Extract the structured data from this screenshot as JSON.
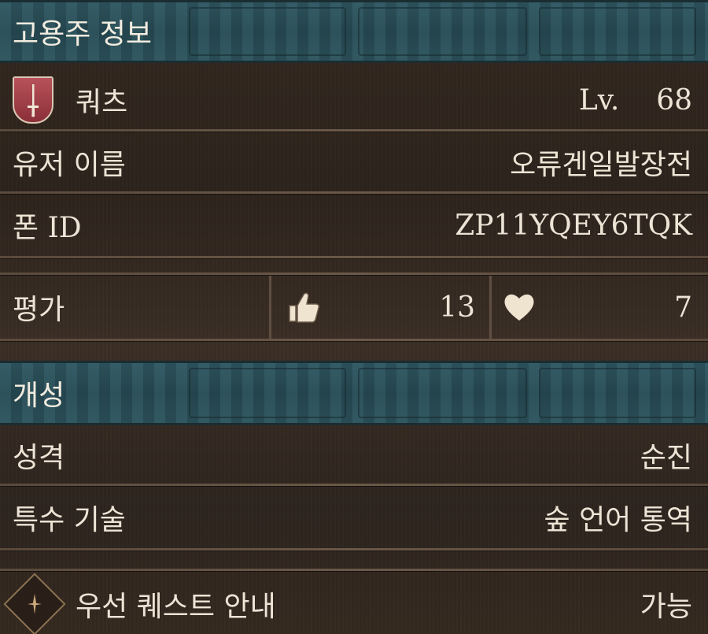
{
  "mercenary_info": {
    "header": "고용주 정보",
    "name": "쿼츠",
    "level_label": "Lv.",
    "level": "68",
    "username_label": "유저 이름",
    "username": "오류겐일발장전",
    "pawn_id_label": "폰 ID",
    "pawn_id": "ZP11YQEY6TQK",
    "rating_label": "평가",
    "likes": "13",
    "favorites": "7"
  },
  "traits": {
    "header": "개성",
    "personality_label": "성격",
    "personality": "순진",
    "special_skill_label": "특수 기술",
    "special_skill": "숲 언어 통역",
    "quest_label": "우선 퀘스트 안내",
    "quest_value": "가능"
  },
  "icons": {
    "class_emblem": "sword-shield-icon",
    "like": "thumbs-up-icon",
    "favorite": "heart-icon",
    "quest": "compass-icon"
  },
  "colors": {
    "header_bg": "#2c525b",
    "emblem_red": "#a8444c",
    "text": "#ede4d6"
  }
}
